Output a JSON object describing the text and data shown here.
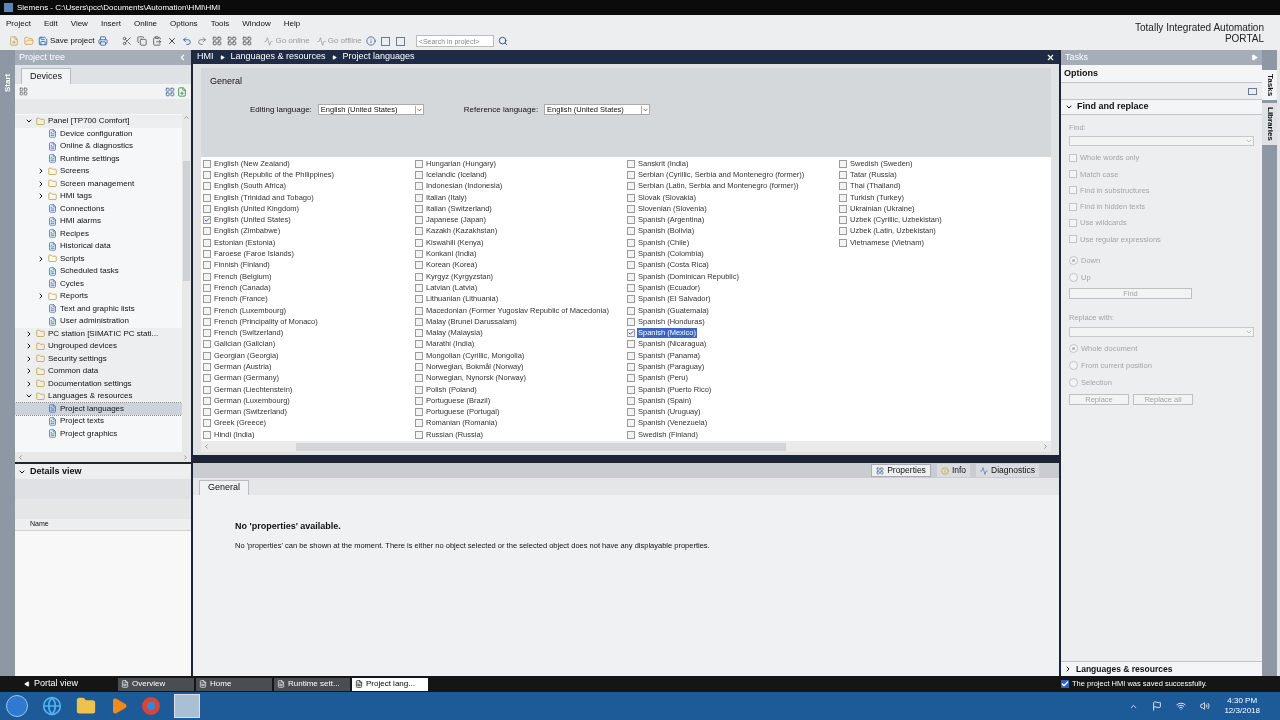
{
  "window": {
    "title": "Siemens  -  C:\\Users\\pcc\\Documents\\Automation\\HMI\\HMI"
  },
  "menu": [
    "Project",
    "Edit",
    "View",
    "Insert",
    "Online",
    "Options",
    "Tools",
    "Window",
    "Help"
  ],
  "toolbar": {
    "save_label": "Save project",
    "go_online": "Go online",
    "go_offline": "Go offline",
    "search_placeholder": "<Search in project>"
  },
  "brand": {
    "line1": "Totally Integrated Automation",
    "line2": "PORTAL"
  },
  "start_tab": "Start",
  "project_tree": {
    "title": "Project tree",
    "tab": "Devices",
    "items": [
      {
        "label": "Panel [TP700 Comfort]",
        "expanded": true,
        "selected": false,
        "children": [
          {
            "label": "Device configuration",
            "selected": false
          },
          {
            "label": "Online & diagnostics",
            "selected": false
          },
          {
            "label": "Runtime settings",
            "selected": false
          },
          {
            "label": "Screens",
            "expanded": false,
            "selected": false
          },
          {
            "label": "Screen management",
            "expanded": false,
            "selected": false
          },
          {
            "label": "HMI tags",
            "expanded": false,
            "selected": false
          },
          {
            "label": "Connections",
            "selected": false
          },
          {
            "label": "HMI alarms",
            "selected": false
          },
          {
            "label": "Recipes",
            "selected": false
          },
          {
            "label": "Historical data",
            "selected": false
          },
          {
            "label": "Scripts",
            "expanded": false,
            "selected": false
          },
          {
            "label": "Scheduled tasks",
            "selected": false
          },
          {
            "label": "Cycles",
            "selected": false
          },
          {
            "label": "Reports",
            "expanded": false,
            "selected": false
          },
          {
            "label": "Text and graphic lists",
            "selected": false
          },
          {
            "label": "User administration",
            "selected": false
          }
        ]
      },
      {
        "label": "PC station [SIMATIC PC stati...",
        "expanded": false,
        "selected": false
      },
      {
        "label": "Ungrouped devices",
        "expanded": false,
        "selected": false
      },
      {
        "label": "Security settings",
        "expanded": false,
        "selected": false
      },
      {
        "label": "Common data",
        "expanded": false,
        "selected": false
      },
      {
        "label": "Documentation settings",
        "expanded": false,
        "selected": false
      },
      {
        "label": "Languages & resources",
        "expanded": true,
        "selected": false,
        "children": [
          {
            "label": "Project languages",
            "selected": true
          },
          {
            "label": "Project texts",
            "selected": false
          },
          {
            "label": "Project graphics",
            "selected": false
          }
        ]
      }
    ]
  },
  "details_view": {
    "title": "Details view",
    "column": "Name"
  },
  "editor": {
    "breadcrumb": [
      "HMI",
      "Languages & resources",
      "Project languages"
    ],
    "section": "General",
    "editing_language": {
      "label": "Editing language:",
      "value": "English (United States)"
    },
    "reference_language": {
      "label": "Reference language:",
      "value": "English (United States)"
    },
    "language_columns": [
      [
        {
          "name": "English (New Zealand)",
          "checked": false,
          "selected": false
        },
        {
          "name": "English (Republic of the Philippines)",
          "checked": false,
          "selected": false
        },
        {
          "name": "English (South Africa)",
          "checked": false,
          "selected": false
        },
        {
          "name": "English (Trinidad and Tobago)",
          "checked": false,
          "selected": false
        },
        {
          "name": "English (United Kingdom)",
          "checked": false,
          "selected": false
        },
        {
          "name": "English (United States)",
          "checked": true,
          "selected": false
        },
        {
          "name": "English (Zimbabwe)",
          "checked": false,
          "selected": false
        },
        {
          "name": "Estonian (Estonia)",
          "checked": false,
          "selected": false
        },
        {
          "name": "Faroese (Faroe Islands)",
          "checked": false,
          "selected": false
        },
        {
          "name": "Finnish (Finland)",
          "checked": false,
          "selected": false
        },
        {
          "name": "French (Belgium)",
          "checked": false,
          "selected": false
        },
        {
          "name": "French (Canada)",
          "checked": false,
          "selected": false
        },
        {
          "name": "French (France)",
          "checked": false,
          "selected": false
        },
        {
          "name": "French (Luxembourg)",
          "checked": false,
          "selected": false
        },
        {
          "name": "French (Principality of Monaco)",
          "checked": false,
          "selected": false
        },
        {
          "name": "French (Switzerland)",
          "checked": false,
          "selected": false
        },
        {
          "name": "Galician (Galician)",
          "checked": false,
          "selected": false
        },
        {
          "name": "Georgian (Georgia)",
          "checked": false,
          "selected": false
        },
        {
          "name": "German (Austria)",
          "checked": false,
          "selected": false
        },
        {
          "name": "German (Germany)",
          "checked": false,
          "selected": false
        },
        {
          "name": "German (Liechtenstein)",
          "checked": false,
          "selected": false
        },
        {
          "name": "German (Luxembourg)",
          "checked": false,
          "selected": false
        },
        {
          "name": "German (Switzerland)",
          "checked": false,
          "selected": false
        },
        {
          "name": "Greek (Greece)",
          "checked": false,
          "selected": false
        },
        {
          "name": "Hindi (India)",
          "checked": false,
          "selected": false
        }
      ],
      [
        {
          "name": "Hungarian (Hungary)",
          "checked": false,
          "selected": false
        },
        {
          "name": "Icelandic (Iceland)",
          "checked": false,
          "selected": false
        },
        {
          "name": "Indonesian (Indonesia)",
          "checked": false,
          "selected": false
        },
        {
          "name": "Italian (Italy)",
          "checked": false,
          "selected": false
        },
        {
          "name": "Italian (Switzerland)",
          "checked": false,
          "selected": false
        },
        {
          "name": "Japanese (Japan)",
          "checked": false,
          "selected": false
        },
        {
          "name": "Kazakh (Kazakhstan)",
          "checked": false,
          "selected": false
        },
        {
          "name": "Kiswahili (Kenya)",
          "checked": false,
          "selected": false
        },
        {
          "name": "Konkani (India)",
          "checked": false,
          "selected": false
        },
        {
          "name": "Korean (Korea)",
          "checked": false,
          "selected": false
        },
        {
          "name": "Kyrgyz (Kyrgyzstan)",
          "checked": false,
          "selected": false
        },
        {
          "name": "Latvian (Latvia)",
          "checked": false,
          "selected": false
        },
        {
          "name": "Lithuanian (Lithuania)",
          "checked": false,
          "selected": false
        },
        {
          "name": "Macedonian (Former Yugoslav Republic of Macedonia)",
          "checked": false,
          "selected": false
        },
        {
          "name": "Malay (Brunei Darussalam)",
          "checked": false,
          "selected": false
        },
        {
          "name": "Malay (Malaysia)",
          "checked": false,
          "selected": false
        },
        {
          "name": "Marathi (India)",
          "checked": false,
          "selected": false
        },
        {
          "name": "Mongolian (Cyrillic, Mongolia)",
          "checked": false,
          "selected": false
        },
        {
          "name": "Norwegian, Bokmål (Norway)",
          "checked": false,
          "selected": false
        },
        {
          "name": "Norwegian, Nynorsk (Norway)",
          "checked": false,
          "selected": false
        },
        {
          "name": "Polish (Poland)",
          "checked": false,
          "selected": false
        },
        {
          "name": "Portuguese (Brazil)",
          "checked": false,
          "selected": false
        },
        {
          "name": "Portuguese (Portugal)",
          "checked": false,
          "selected": false
        },
        {
          "name": "Romanian (Romania)",
          "checked": false,
          "selected": false
        },
        {
          "name": "Russian (Russia)",
          "checked": false,
          "selected": false
        }
      ],
      [
        {
          "name": "Sanskrit (India)",
          "checked": false,
          "selected": false
        },
        {
          "name": "Serbian (Cyrillic, Serbia and Montenegro (former))",
          "checked": false,
          "selected": false
        },
        {
          "name": "Serbian (Latin, Serbia and Montenegro (former))",
          "checked": false,
          "selected": false
        },
        {
          "name": "Slovak (Slovakia)",
          "checked": false,
          "selected": false
        },
        {
          "name": "Slovenian (Slovenia)",
          "checked": false,
          "selected": false
        },
        {
          "name": "Spanish (Argentina)",
          "checked": false,
          "selected": false
        },
        {
          "name": "Spanish (Bolivia)",
          "checked": false,
          "selected": false
        },
        {
          "name": "Spanish (Chile)",
          "checked": false,
          "selected": false
        },
        {
          "name": "Spanish (Colombia)",
          "checked": false,
          "selected": false
        },
        {
          "name": "Spanish (Costa Rica)",
          "checked": false,
          "selected": false
        },
        {
          "name": "Spanish (Dominican Republic)",
          "checked": false,
          "selected": false
        },
        {
          "name": "Spanish (Ecuador)",
          "checked": false,
          "selected": false
        },
        {
          "name": "Spanish (El Salvador)",
          "checked": false,
          "selected": false
        },
        {
          "name": "Spanish (Guatemala)",
          "checked": false,
          "selected": false
        },
        {
          "name": "Spanish (Honduras)",
          "checked": false,
          "selected": false
        },
        {
          "name": "Spanish (Mexico)",
          "checked": true,
          "selected": true
        },
        {
          "name": "Spanish (Nicaragua)",
          "checked": false,
          "selected": false
        },
        {
          "name": "Spanish (Panama)",
          "checked": false,
          "selected": false
        },
        {
          "name": "Spanish (Paraguay)",
          "checked": false,
          "selected": false
        },
        {
          "name": "Spanish (Peru)",
          "checked": false,
          "selected": false
        },
        {
          "name": "Spanish (Puerto Rico)",
          "checked": false,
          "selected": false
        },
        {
          "name": "Spanish (Spain)",
          "checked": false,
          "selected": false
        },
        {
          "name": "Spanish (Uruguay)",
          "checked": false,
          "selected": false
        },
        {
          "name": "Spanish (Venezuela)",
          "checked": false,
          "selected": false
        },
        {
          "name": "Swedish (Finland)",
          "checked": false,
          "selected": false
        }
      ],
      [
        {
          "name": "Swedish (Sweden)",
          "checked": false,
          "selected": false
        },
        {
          "name": "Tatar (Russia)",
          "checked": false,
          "selected": false
        },
        {
          "name": "Thai (Thailand)",
          "checked": false,
          "selected": false
        },
        {
          "name": "Turkish (Turkey)",
          "checked": false,
          "selected": false
        },
        {
          "name": "Ukrainian (Ukraine)",
          "checked": false,
          "selected": false
        },
        {
          "name": "Uzbek (Cyrillic, Uzbekistan)",
          "checked": false,
          "selected": false
        },
        {
          "name": "Uzbek (Latin, Uzbekistan)",
          "checked": false,
          "selected": false
        },
        {
          "name": "Vietnamese (Vietnam)",
          "checked": false,
          "selected": false
        }
      ]
    ]
  },
  "inspector": {
    "tabs": [
      {
        "label": "Properties",
        "selected": true
      },
      {
        "label": "Info",
        "selected": false
      },
      {
        "label": "Diagnostics",
        "selected": false
      }
    ],
    "subtab": "General",
    "message_title": "No 'properties' available.",
    "message_body": "No 'properties' can be shown at the moment. There is either no object selected or the selected object does not have any displayable properties."
  },
  "tasks": {
    "title": "Tasks",
    "options": "Options",
    "section": {
      "title": "Find and replace",
      "expanded": true
    },
    "find_label": "Find:",
    "checkboxes": [
      {
        "label": "Whole words only",
        "checked": false
      },
      {
        "label": "Match case",
        "checked": false
      },
      {
        "label": "Find in substructures",
        "checked": false
      },
      {
        "label": "Find in hidden texts",
        "checked": false
      },
      {
        "label": "Use wildcards",
        "checked": false
      },
      {
        "label": "Use regular expressions",
        "checked": false
      }
    ],
    "direction": [
      {
        "label": "Down",
        "selected": true
      },
      {
        "label": "Up",
        "selected": false
      }
    ],
    "find_button": "Find",
    "replace_label": "Replace with:",
    "scope": [
      {
        "label": "Whole document",
        "selected": true
      },
      {
        "label": "From current position",
        "selected": false
      },
      {
        "label": "Selection",
        "selected": false
      }
    ],
    "buttons": [
      "Replace",
      "Replace all"
    ],
    "bottom_section": {
      "title": "Languages & resources",
      "expanded": false
    }
  },
  "side_tabs": [
    {
      "label": "Tasks",
      "selected": true
    },
    {
      "label": "Libraries",
      "selected": false
    }
  ],
  "status_bar": {
    "portal_view": "Portal view",
    "windows": [
      {
        "label": "Overview",
        "selected": false
      },
      {
        "label": "Home",
        "selected": false
      },
      {
        "label": "Runtime sett...",
        "selected": false
      },
      {
        "label": "Project lang...",
        "selected": true
      }
    ],
    "message": "The project HMI was saved successfully."
  },
  "taskbar": {
    "time": "4:30 PM",
    "date": "12/3/2018"
  }
}
